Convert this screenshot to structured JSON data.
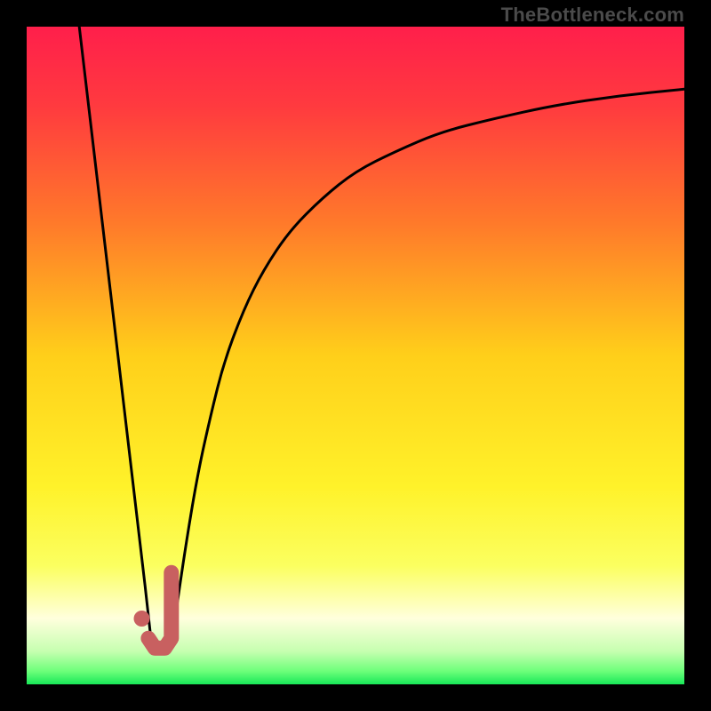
{
  "watermark": "TheBottleneck.com",
  "colors": {
    "frame": "#000000",
    "gradient_stops": [
      {
        "offset": 0.0,
        "color": "#ff1f4b"
      },
      {
        "offset": 0.12,
        "color": "#ff3a3f"
      },
      {
        "offset": 0.3,
        "color": "#ff7a2a"
      },
      {
        "offset": 0.5,
        "color": "#ffcf1a"
      },
      {
        "offset": 0.7,
        "color": "#fff22a"
      },
      {
        "offset": 0.82,
        "color": "#fbff60"
      },
      {
        "offset": 0.9,
        "color": "#ffffdd"
      },
      {
        "offset": 0.95,
        "color": "#c6ffb0"
      },
      {
        "offset": 0.98,
        "color": "#6dff7a"
      },
      {
        "offset": 1.0,
        "color": "#18e858"
      }
    ],
    "curve": "#000000",
    "marker": "#c86060"
  },
  "chart_data": {
    "type": "line",
    "title": "",
    "xlabel": "",
    "ylabel": "",
    "xlim": [
      0,
      100
    ],
    "ylim": [
      0,
      100
    ],
    "series": [
      {
        "name": "left-branch",
        "x": [
          8,
          10,
          12,
          14,
          16,
          18,
          19
        ],
        "y": [
          100,
          83,
          66,
          49,
          32,
          15,
          6
        ]
      },
      {
        "name": "right-branch",
        "x": [
          22,
          24,
          26,
          28,
          30,
          33,
          36,
          40,
          45,
          50,
          56,
          63,
          71,
          80,
          90,
          100
        ],
        "y": [
          6,
          20,
          32,
          41,
          49,
          57,
          63,
          69,
          74,
          78,
          81,
          84,
          86,
          88,
          89.5,
          90.5
        ]
      }
    ],
    "marker_J": {
      "dot": {
        "x": 17.5,
        "y": 10
      },
      "stroke_points": [
        {
          "x": 22,
          "y": 17
        },
        {
          "x": 22,
          "y": 7
        },
        {
          "x": 21,
          "y": 5.5
        },
        {
          "x": 19.5,
          "y": 5.5
        },
        {
          "x": 18.5,
          "y": 7
        }
      ]
    }
  }
}
